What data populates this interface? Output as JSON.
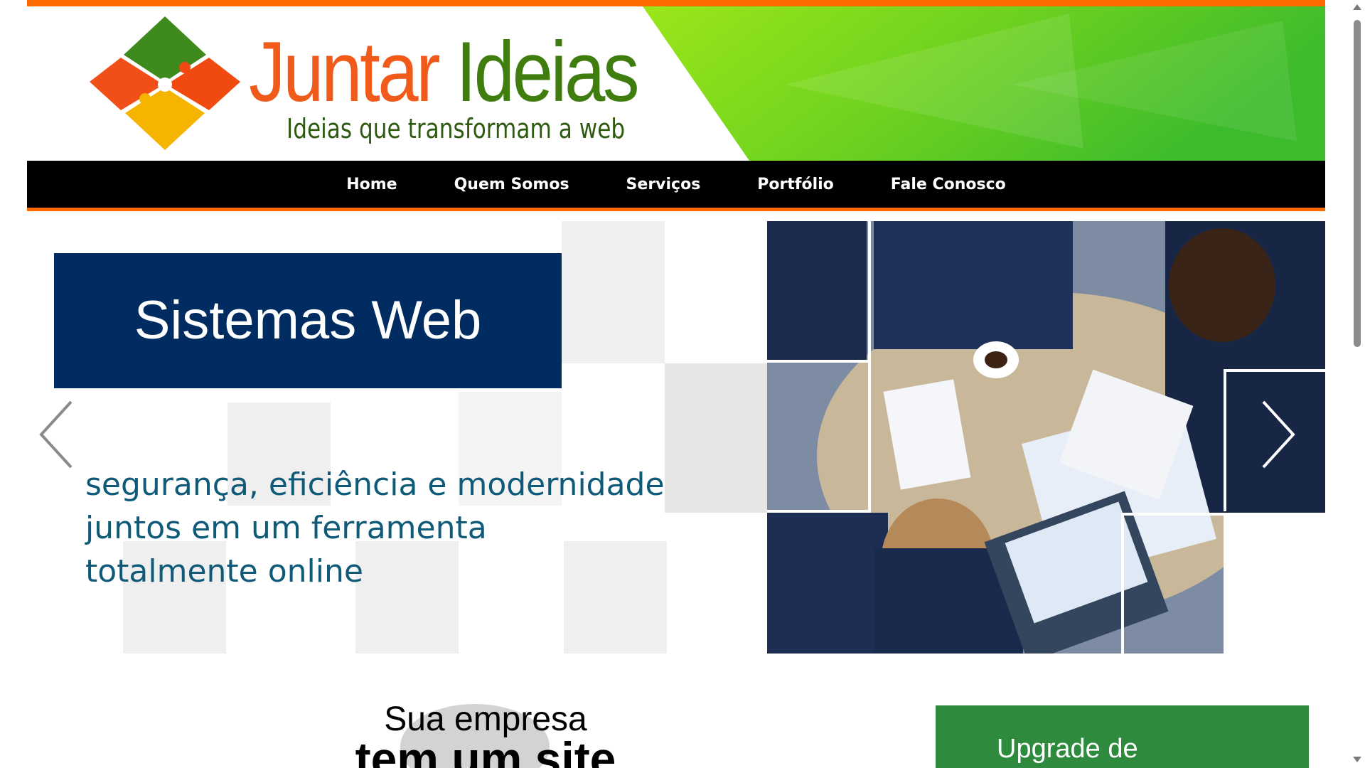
{
  "header": {
    "logo_word1": "Juntar",
    "logo_word2": "Ideias",
    "tagline": "Ideias que transformam a web",
    "logo_icon": "puzzle-icon",
    "colors": {
      "accent_orange": "#ff6a00",
      "logo_green": "#3f7d0f",
      "logo_orange": "#f05a1a",
      "header_green": "#7ed321"
    }
  },
  "nav": {
    "items": [
      {
        "label": "Home"
      },
      {
        "label": "Quem Somos"
      },
      {
        "label": "Serviços"
      },
      {
        "label": "Portfólio"
      },
      {
        "label": "Fale Conosco"
      }
    ],
    "colors": {
      "background": "#000000",
      "text": "#ffffff"
    }
  },
  "slider": {
    "title": "Sistemas Web",
    "lines": [
      "segurança, eficiência e modernidade",
      "juntos em um ferramenta",
      "totalmente online"
    ],
    "prev_icon": "chevron-left-icon",
    "next_icon": "chevron-right-icon",
    "colors": {
      "title_box": "#002c62",
      "copy_text": "#0f5a78"
    }
  },
  "promo": {
    "line1": "Sua empresa",
    "line2": "tem um site"
  },
  "upgrade": {
    "text": "Upgrade de",
    "color": "#2e8b3e"
  }
}
